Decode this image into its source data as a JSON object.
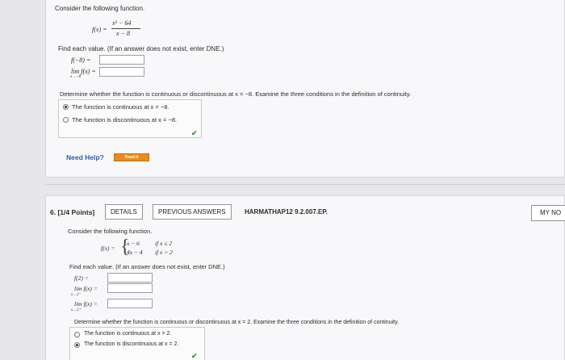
{
  "problem5": {
    "intro": "Consider the following function.",
    "function_lhs": "f(x) =",
    "numerator": "x² − 64",
    "denominator": "x − 8",
    "instructions": "Find each value. (If an answer does not exist, enter DNE.)",
    "items": [
      {
        "label": "f(−8) =",
        "value": ""
      },
      {
        "label": "lim f(x) =",
        "sublabel": "x→−8",
        "value": ""
      }
    ],
    "question": "Determine whether the function is continuous or discontinuous at x = −8. Examine the three conditions in the definition of continuity.",
    "options": [
      {
        "label": "The function is continuous at x = −8.",
        "selected": true
      },
      {
        "label": "The function is discontinuous at x = −8.",
        "selected": false
      }
    ],
    "need_help": "Need Help?",
    "read_it": "Read It"
  },
  "problem6": {
    "header": "6.  [1/4 Points]",
    "details_button": "DETAILS",
    "previous_answers_button": "PREVIOUS ANSWERS",
    "code": "HARMATHAP12 9.2.007.EP.",
    "my_notes_button": "MY NO",
    "intro": "Consider the following function.",
    "function_lhs": "f(x) =",
    "pieces": [
      {
        "expr": "x − 6",
        "cond": "if x ≤ 2"
      },
      {
        "expr": "4x − 4",
        "cond": "if x > 2"
      }
    ],
    "instructions": "Find each value. (If an answer does not exist, enter DNE.)",
    "items": [
      {
        "label": "f(2) =",
        "value": ""
      },
      {
        "label": "lim f(x) =",
        "sublabel": "x→2⁻",
        "value": ""
      },
      {
        "label": "lim f(x) =",
        "sublabel": "x→2⁺",
        "value": ""
      }
    ],
    "question": "Determine whether the function is continuous or discontinuous at x = 2. Examine the three conditions in the definition of continuity.",
    "options": [
      {
        "label": "The function is continuous at x = 2.",
        "selected": false
      },
      {
        "label": "The function is discontinuous at x = 2.",
        "selected": true
      }
    ]
  },
  "colors": {
    "accent_check": "#3a9a3a",
    "need_help": "#2b5fa8",
    "read_it": "#e98a1f"
  }
}
